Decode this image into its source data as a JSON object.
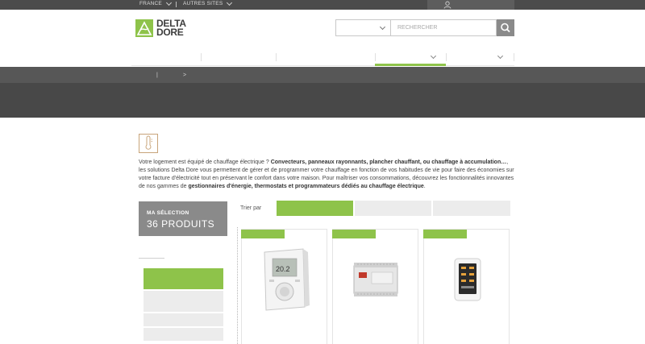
{
  "topbar": {
    "country": "FRANCE",
    "other_sites": "AUTRES SITES"
  },
  "header": {
    "logo_line1": "DELTA",
    "logo_line2": "DORE",
    "search_placeholder": "RECHERCHER"
  },
  "breadcrumb": {
    "separator": "|",
    "arrow": ">"
  },
  "intro": {
    "p1": "Votre logement est équipé de chauffage électrique ? ",
    "b1": "Convecteurs, panneaux rayonnants, plancher chauffant, ou chauffage à accumulation…",
    "p2": ", les solutions Delta Dore vous permettent de gérer et de programmer votre chauffage en fonction de vos habitudes de vie pour faire des économies sur votre facture d'électricité tout en préservant le confort dans votre maison. Pour maîtriser vos consommations, découvrez les fonctionnalités innovantes de nos gammes de ",
    "b2": "gestionnaires d'énergie, thermostats et programmateurs dédiés au chauffage électrique",
    "p3": "."
  },
  "selection": {
    "label": "MA SÉLECTION",
    "count": "36 PRODUITS"
  },
  "sort": {
    "label": "Trier par"
  },
  "colors": {
    "accent": "#8ec34a",
    "topbar": "#4b4b4b",
    "banner": "#484848",
    "selection_bg": "#8a8a8a"
  },
  "icons": {
    "user": "user-icon",
    "search": "magnifier-icon",
    "thermometer": "thermometer-icon"
  }
}
